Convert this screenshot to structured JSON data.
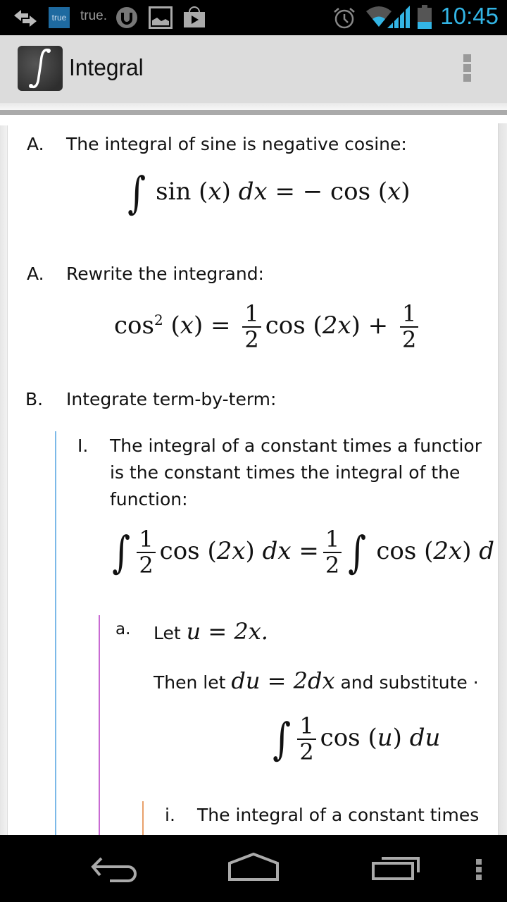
{
  "status_bar": {
    "notification_icons": [
      "data-transfer-icon",
      "true-app-icon",
      "true-brand-icon",
      "utorrent-icon",
      "gallery-icon",
      "play-store-icon"
    ],
    "true_badge": "true",
    "true_brand": "true.",
    "system_icons": [
      "alarm-icon",
      "wifi-icon",
      "signal-icon",
      "battery-icon"
    ],
    "time": "10:45",
    "accent": "#33b5e5"
  },
  "action_bar": {
    "title": "Integral",
    "app_icon": "integral-symbol-icon",
    "overflow": "overflow-menu-icon"
  },
  "steps": [
    {
      "marker": "A.",
      "text": "The integral of sine is negative cosine:",
      "math": {
        "lhs_fn": "sin",
        "var": "x",
        "dvar": "dx",
        "rhs": "− cos",
        "rhs_var": "x"
      }
    },
    {
      "marker": "A.",
      "text": "Rewrite the integrand:",
      "math": {
        "lhs": "cos",
        "exp": "2",
        "var": "x",
        "eq": "=",
        "num": "1",
        "den": "2",
        "mid": "cos",
        "arg": "2x",
        "plus": "+",
        "num2": "1",
        "den2": "2"
      }
    },
    {
      "marker": "B.",
      "text": "Integrate term-by-term:"
    }
  ],
  "substeps": [
    {
      "marker": "I.",
      "lines": [
        "The integral of a constant times a functior",
        "is the constant times the integral of the",
        "function:"
      ],
      "math": {
        "num": "1",
        "den": "2",
        "fn": "cos",
        "arg": "2x",
        "dvar": "dx",
        "eq": "=",
        "num2": "1",
        "den2": "2",
        "fn2": "cos",
        "arg2": "2x",
        "tail": "d"
      }
    }
  ],
  "subsub": {
    "marker": "a.",
    "let_prefix": "Let",
    "let_math": "u = 2x.",
    "then_prefix": "Then let",
    "then_math": "du = 2dx",
    "then_suffix": "and substitute ·",
    "math": {
      "num": "1",
      "den": "2",
      "fn": "cos",
      "arg": "u",
      "dvar": "du"
    }
  },
  "level4": {
    "marker": "i.",
    "text": "The integral of a constant times"
  },
  "colors": {
    "level1_line": "#7cb9e8",
    "level2_line": "#c86ad2",
    "level3_line": "#e8a06a"
  },
  "nav_bar": {
    "buttons": [
      "back-button",
      "home-button",
      "recent-apps-button",
      "menu-button"
    ]
  }
}
